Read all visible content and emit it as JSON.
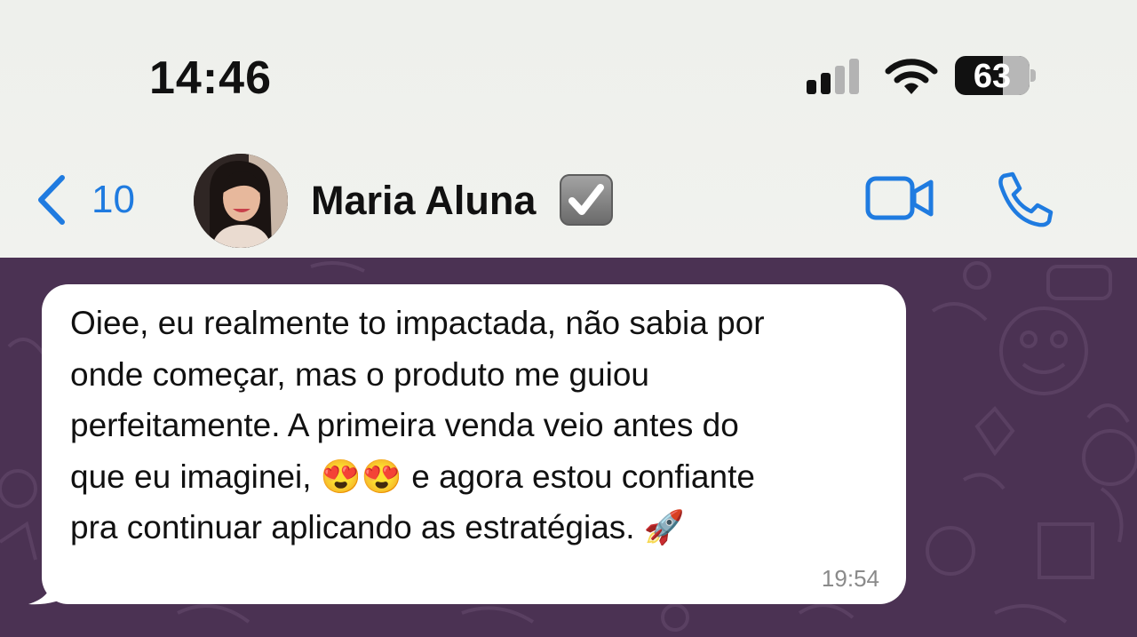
{
  "status_bar": {
    "time": "14:46",
    "battery": "63",
    "signal_bars_active": 2,
    "signal_bars_total": 4
  },
  "header": {
    "back_count": "10",
    "contact_name": "Maria Aluna",
    "icons": [
      "chevron-left-icon",
      "avatar",
      "verified-check-icon",
      "video-call-icon",
      "phone-icon"
    ],
    "accent_color": "#1f7be0"
  },
  "chat": {
    "background_color": "#4b3253",
    "message": {
      "text": "Oiee, eu realmente to impactada, não sabia por\nonde começar, mas o produto me guiou\nperfeitamente. A primeira venda veio antes do\nque eu imaginei, 😍😍 e agora estou confiante\npra continuar aplicando as estratégias. 🚀",
      "time": "19:54"
    }
  }
}
